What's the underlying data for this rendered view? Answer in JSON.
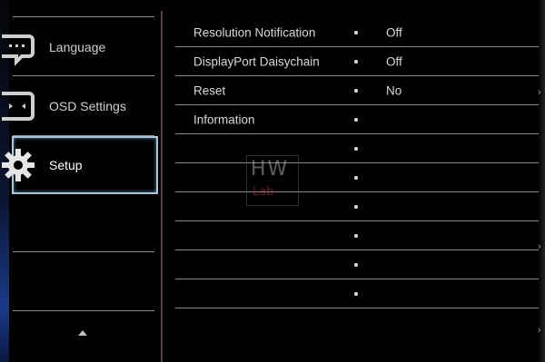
{
  "sidebar": {
    "items": [
      {
        "label": "Language",
        "icon": "language-icon"
      },
      {
        "label": "OSD Settings",
        "icon": "osd-settings-icon"
      },
      {
        "label": "Setup",
        "icon": "setup-gear-icon",
        "active": true
      }
    ]
  },
  "panel": {
    "rows": [
      {
        "name": "Resolution Notification",
        "value": "Off"
      },
      {
        "name": "DisplayPort Daisychain",
        "value": "Off"
      },
      {
        "name": "Reset",
        "value": "No"
      },
      {
        "name": "Information",
        "value": ""
      },
      {
        "name": "",
        "value": ""
      },
      {
        "name": "",
        "value": ""
      },
      {
        "name": "",
        "value": ""
      },
      {
        "name": "",
        "value": ""
      },
      {
        "name": "",
        "value": ""
      },
      {
        "name": "",
        "value": ""
      }
    ]
  },
  "watermark": {
    "main": "HW",
    "sub": "Lab"
  },
  "colors": {
    "active_border": "#a9c6dc",
    "background": "#000000",
    "text": "#d8d8d8"
  }
}
